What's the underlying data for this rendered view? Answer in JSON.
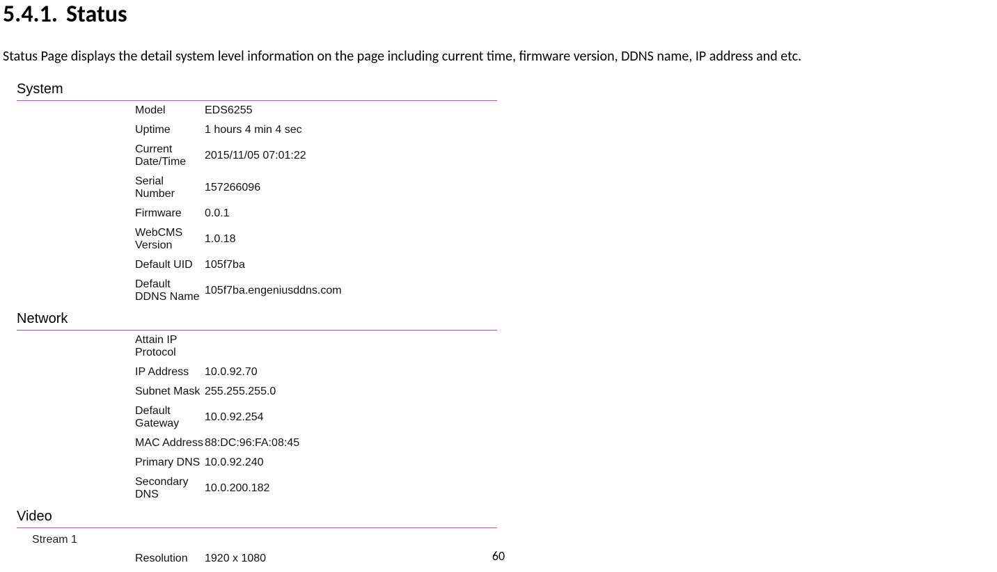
{
  "heading_number": "5.4.1.",
  "heading_title": "Status",
  "intro": "Status Page displays the detail system level information on the page including current time, firmware version, DDNS name, IP address and etc.",
  "sections": {
    "system": {
      "title": "System",
      "rows": [
        {
          "label": "Model",
          "value": "EDS6255"
        },
        {
          "label": "Uptime",
          "value": "1 hours 4 min 4 sec"
        },
        {
          "label": "Current Date/Time",
          "value": "2015/11/05 07:01:22"
        },
        {
          "label": "Serial Number",
          "value": "157266096"
        },
        {
          "label": "Firmware",
          "value": "0.0.1"
        },
        {
          "label": "WebCMS Version",
          "value": "1.0.18"
        },
        {
          "label": "Default UID",
          "value": "105f7ba"
        },
        {
          "label": "Default DDNS Name",
          "value": "105f7ba.engeniusddns.com"
        }
      ]
    },
    "network": {
      "title": "Network",
      "rows": [
        {
          "label": "Attain IP Protocol",
          "value": ""
        },
        {
          "label": "IP Address",
          "value": "10.0.92.70"
        },
        {
          "label": "Subnet Mask",
          "value": "255.255.255.0"
        },
        {
          "label": "Default Gateway",
          "value": "10.0.92.254"
        },
        {
          "label": "MAC Address",
          "value": "88:DC:96:FA:08:45"
        },
        {
          "label": "Primary DNS",
          "value": "10.0.92.240"
        },
        {
          "label": "Secondary DNS",
          "value": "10.0.200.182"
        }
      ]
    },
    "video": {
      "title": "Video",
      "sub": "Stream 1",
      "rows": [
        {
          "label": "Resolution",
          "value": "1920 x 1080"
        }
      ]
    }
  },
  "page_number": "60"
}
